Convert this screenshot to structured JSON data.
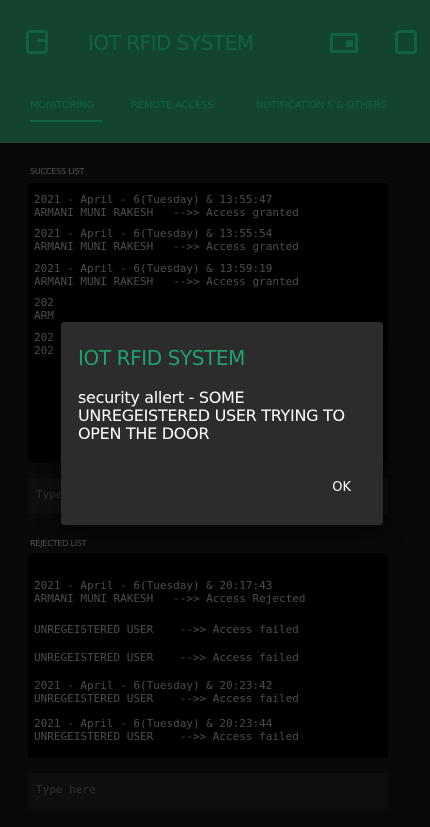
{
  "app": {
    "title": "IOT RFID SYSTEM"
  },
  "tabs": [
    {
      "label": "MONITORING",
      "active": true
    },
    {
      "label": "REMOTE ACCESS",
      "active": false
    },
    {
      "label": "NOTIFICATION S & OTHERS",
      "active": false
    }
  ],
  "success": {
    "label": "SUCCESS LIST",
    "entries": [
      "2021 - April - 6(Tuesday) & 13:55:47\nARMANI MUNI RAKESH   -->> Access granted",
      "2021 - April - 6(Tuesday) & 13:55:54\nARMANI MUNI RAKESH   -->> Access granted",
      "2021 - April - 6(Tuesday) & 13:59:19\nARMANI MUNI RAKESH   -->> Access granted",
      "202\nARM",
      "202\n202"
    ],
    "input_placeholder": "Type"
  },
  "rejected": {
    "label": "REJECTED LIST",
    "entries": [
      "2021 - April - 6(Tuesday) & 20:17:43\nARMANI MUNI RAKESH   -->> Access Rejected",
      "UNREGEISTERED USER    -->> Access failed",
      "UNREGEISTERED USER    -->> Access failed",
      "2021 - April - 6(Tuesday) & 20:23:42\nUNREGEISTERED USER    -->> Access failed",
      "2021 - April - 6(Tuesday) & 20:23:44\nUNREGEISTERED USER    -->> Access failed"
    ],
    "input_placeholder": "Type here"
  },
  "dialog": {
    "title": "IOT RFID SYSTEM",
    "message": "security allert - SOME UNREGEISTERED USER TRYING TO OPEN THE DOOR",
    "ok_label": "OK"
  },
  "colors": {
    "accent": "#1a9e6a",
    "appbar": "#1f6e4d",
    "dialog_bg": "#2c2c2c"
  },
  "icons": [
    "back-box-icon",
    "battery-icon",
    "square-icon"
  ]
}
